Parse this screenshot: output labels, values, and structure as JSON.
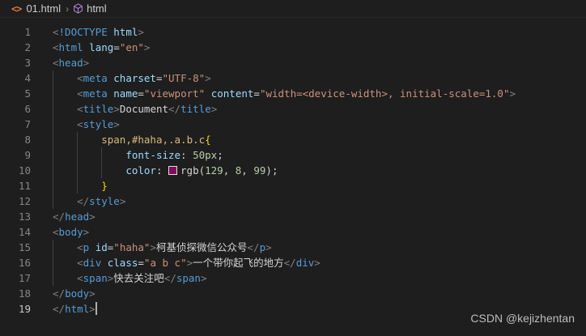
{
  "breadcrumb": {
    "file_icon": "<>",
    "file_name": "01.html",
    "separator": "›",
    "symbol_icon": "cube-icon",
    "symbol_name": "html"
  },
  "editor": {
    "active_line": 19,
    "lines": [
      {
        "n": "1",
        "t": [
          [
            "bracket",
            "<"
          ],
          [
            "tag",
            "!DOCTYPE"
          ],
          [
            "txt",
            " "
          ],
          [
            "attr",
            "html"
          ],
          [
            "bracket",
            ">"
          ]
        ]
      },
      {
        "n": "2",
        "t": [
          [
            "bracket",
            "<"
          ],
          [
            "tag",
            "html"
          ],
          [
            "txt",
            " "
          ],
          [
            "attr",
            "lang"
          ],
          [
            "txt",
            "="
          ],
          [
            "str",
            "\"en\""
          ],
          [
            "bracket",
            ">"
          ]
        ]
      },
      {
        "n": "3",
        "t": [
          [
            "bracket",
            "<"
          ],
          [
            "tag",
            "head"
          ],
          [
            "bracket",
            ">"
          ]
        ]
      },
      {
        "n": "4",
        "t": [
          [
            "txt",
            "    "
          ],
          [
            "bracket",
            "<"
          ],
          [
            "tag",
            "meta"
          ],
          [
            "txt",
            " "
          ],
          [
            "attr",
            "charset"
          ],
          [
            "txt",
            "="
          ],
          [
            "str",
            "\"UTF-8\""
          ],
          [
            "bracket",
            ">"
          ]
        ]
      },
      {
        "n": "5",
        "t": [
          [
            "txt",
            "    "
          ],
          [
            "bracket",
            "<"
          ],
          [
            "tag",
            "meta"
          ],
          [
            "txt",
            " "
          ],
          [
            "attr",
            "name"
          ],
          [
            "txt",
            "="
          ],
          [
            "str",
            "\"viewport\""
          ],
          [
            "txt",
            " "
          ],
          [
            "attr",
            "content"
          ],
          [
            "txt",
            "="
          ],
          [
            "str",
            "\"width=<device-width>, initial-scale=1.0\""
          ],
          [
            "bracket",
            ">"
          ]
        ]
      },
      {
        "n": "6",
        "t": [
          [
            "txt",
            "    "
          ],
          [
            "bracket",
            "<"
          ],
          [
            "tag",
            "title"
          ],
          [
            "bracket",
            ">"
          ],
          [
            "txt",
            "Document"
          ],
          [
            "bracket",
            "</"
          ],
          [
            "tag",
            "title"
          ],
          [
            "bracket",
            ">"
          ]
        ]
      },
      {
        "n": "7",
        "t": [
          [
            "txt",
            "    "
          ],
          [
            "bracket",
            "<"
          ],
          [
            "tag",
            "style"
          ],
          [
            "bracket",
            ">"
          ]
        ]
      },
      {
        "n": "8",
        "t": [
          [
            "txt",
            "        "
          ],
          [
            "sel",
            "span,#haha,.a.b.c"
          ],
          [
            "brace",
            "{"
          ]
        ]
      },
      {
        "n": "9",
        "t": [
          [
            "txt",
            "            "
          ],
          [
            "prop",
            "font-size"
          ],
          [
            "txt",
            ": "
          ],
          [
            "num",
            "50px"
          ],
          [
            "txt",
            ";"
          ]
        ]
      },
      {
        "n": "10",
        "t": [
          [
            "txt",
            "            "
          ],
          [
            "prop",
            "color"
          ],
          [
            "txt",
            ": "
          ],
          [
            "swatch",
            "#810863"
          ],
          [
            "txt",
            "rgb("
          ],
          [
            "num",
            "129"
          ],
          [
            "txt",
            ", "
          ],
          [
            "num",
            "8"
          ],
          [
            "txt",
            ", "
          ],
          [
            "num",
            "99"
          ],
          [
            "txt",
            ");"
          ]
        ]
      },
      {
        "n": "11",
        "t": [
          [
            "txt",
            "        "
          ],
          [
            "brace",
            "}"
          ]
        ]
      },
      {
        "n": "12",
        "t": [
          [
            "txt",
            "    "
          ],
          [
            "bracket",
            "</"
          ],
          [
            "tag",
            "style"
          ],
          [
            "bracket",
            ">"
          ]
        ]
      },
      {
        "n": "13",
        "t": [
          [
            "bracket",
            "</"
          ],
          [
            "tag",
            "head"
          ],
          [
            "bracket",
            ">"
          ]
        ]
      },
      {
        "n": "14",
        "t": [
          [
            "bracket",
            "<"
          ],
          [
            "tag",
            "body"
          ],
          [
            "bracket",
            ">"
          ]
        ]
      },
      {
        "n": "15",
        "t": [
          [
            "txt",
            "    "
          ],
          [
            "bracket",
            "<"
          ],
          [
            "tag",
            "p"
          ],
          [
            "txt",
            " "
          ],
          [
            "attr",
            "id"
          ],
          [
            "txt",
            "="
          ],
          [
            "str",
            "\"haha\""
          ],
          [
            "bracket",
            ">"
          ],
          [
            "txt",
            "柯基侦探微信公众号"
          ],
          [
            "bracket",
            "</"
          ],
          [
            "tag",
            "p"
          ],
          [
            "bracket",
            ">"
          ]
        ]
      },
      {
        "n": "16",
        "t": [
          [
            "txt",
            "    "
          ],
          [
            "bracket",
            "<"
          ],
          [
            "tag",
            "div"
          ],
          [
            "txt",
            " "
          ],
          [
            "attr",
            "class"
          ],
          [
            "txt",
            "="
          ],
          [
            "str",
            "\"a b c\""
          ],
          [
            "bracket",
            ">"
          ],
          [
            "txt",
            "一个带你起飞的地方"
          ],
          [
            "bracket",
            "</"
          ],
          [
            "tag",
            "div"
          ],
          [
            "bracket",
            ">"
          ]
        ]
      },
      {
        "n": "17",
        "t": [
          [
            "txt",
            "    "
          ],
          [
            "bracket",
            "<"
          ],
          [
            "tag",
            "span"
          ],
          [
            "bracket",
            ">"
          ],
          [
            "txt",
            "快去关注吧"
          ],
          [
            "bracket",
            "</"
          ],
          [
            "tag",
            "span"
          ],
          [
            "bracket",
            ">"
          ]
        ]
      },
      {
        "n": "18",
        "t": [
          [
            "bracket",
            "</"
          ],
          [
            "tag",
            "body"
          ],
          [
            "bracket",
            ">"
          ]
        ]
      },
      {
        "n": "19",
        "t": [
          [
            "bracket",
            "</"
          ],
          [
            "tag",
            "html"
          ],
          [
            "bracket",
            ">"
          ]
        ]
      }
    ]
  },
  "watermark": "CSDN @kejizhentan",
  "colors": {
    "background": "#1e1e1e",
    "tag": "#569cd6",
    "attribute": "#9cdcfe",
    "string": "#ce9178",
    "selector": "#d7ba7d",
    "brace": "#ffd700",
    "number": "#b5cea8",
    "swatch": "#810863"
  }
}
